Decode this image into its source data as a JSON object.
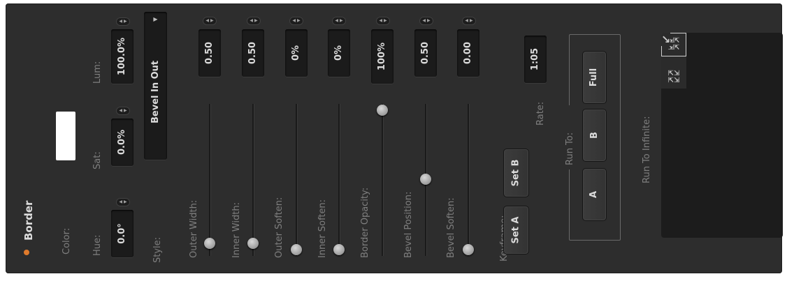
{
  "section": {
    "title": "Border",
    "active_color": "#e07b2c"
  },
  "color": {
    "label": "Color:",
    "swatch": "#ffffff"
  },
  "hue": {
    "label": "Hue:",
    "value": "0.0°"
  },
  "sat": {
    "label": "Sat:",
    "value": "0.0%"
  },
  "lum": {
    "label": "Lum:",
    "value": "100.0%"
  },
  "style": {
    "label": "Style:",
    "value": "Bevel In Out"
  },
  "sliders": [
    {
      "label": "Outer Width:",
      "value": "0.50"
    },
    {
      "label": "Inner Width:",
      "value": "0.50"
    },
    {
      "label": "Outer Soften:",
      "value": "0%"
    },
    {
      "label": "Inner Soften:",
      "value": "0%"
    },
    {
      "label": "Border Opacity:",
      "value": "100%"
    },
    {
      "label": "Bevel Position:",
      "value": "0.50"
    },
    {
      "label": "Bevel Soften:",
      "value": "0.00"
    }
  ],
  "keyframe": {
    "label": "Keyframe:",
    "set_a": "Set A",
    "set_b": "Set B",
    "rate_label": "Rate:",
    "rate_value": "1:05"
  },
  "run_to": {
    "label": "Run To:",
    "a": "A",
    "b": "B",
    "full": "Full"
  },
  "run_to_infinite": {
    "label": "Run To Infinite:"
  },
  "icons": {
    "stepper": "left-right-arrows-icon",
    "dropdown": "dropdown-arrow-icon",
    "pad": [
      "arrow-up-left-icon",
      "arrow-up-icon",
      "arrow-up-right-icon",
      "arrow-left-icon",
      "shrink-center-icon",
      "arrow-right-icon",
      "arrow-down-left-icon",
      "arrow-down-icon",
      "arrow-down-right-icon",
      "expand-center-icon"
    ]
  }
}
